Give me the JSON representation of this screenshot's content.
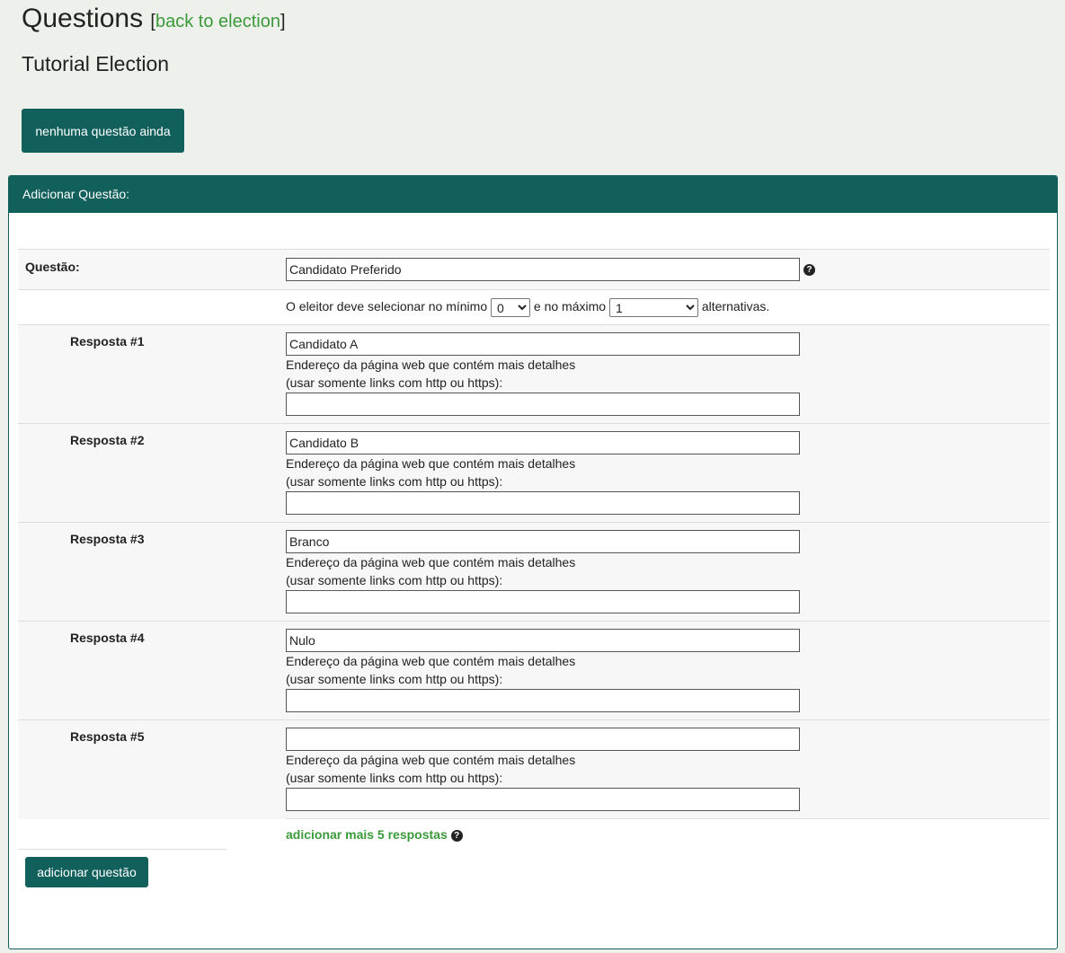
{
  "header": {
    "title": "Questions",
    "bracket_open": "[",
    "back_link": "back to election",
    "bracket_close": "]",
    "election_name": "Tutorial Election",
    "no_questions_button": "nenhuma questão ainda"
  },
  "panel": {
    "title": "Adicionar Questão:",
    "question_label": "Questão:",
    "question_value": "Candidato Preferido",
    "help_icon": "question-circle-icon",
    "min_max": {
      "prefix": "O eleitor deve selecionar no mínimo",
      "min_value": "0",
      "middle": "e no máximo",
      "max_value": "1",
      "suffix": "alternativas."
    },
    "answers": [
      {
        "label": "Resposta #1",
        "value": "Candidato A",
        "url_hint_1": "Endereço da página web que contém mais detalhes",
        "url_hint_2": "(usar somente links com http ou https):",
        "url_value": ""
      },
      {
        "label": "Resposta #2",
        "value": "Candidato B",
        "url_hint_1": "Endereço da página web que contém mais detalhes",
        "url_hint_2": "(usar somente links com http ou https):",
        "url_value": ""
      },
      {
        "label": "Resposta #3",
        "value": "Branco",
        "url_hint_1": "Endereço da página web que contém mais detalhes",
        "url_hint_2": "(usar somente links com http ou https):",
        "url_value": ""
      },
      {
        "label": "Resposta #4",
        "value": "Nulo",
        "url_hint_1": "Endereço da página web que contém mais detalhes",
        "url_hint_2": "(usar somente links com http ou https):",
        "url_value": ""
      },
      {
        "label": "Resposta #5",
        "value": "",
        "url_hint_1": "Endereço da página web que contém mais detalhes",
        "url_hint_2": "(usar somente links com http ou https):",
        "url_value": ""
      }
    ],
    "add_more_link": "adicionar mais 5 respostas",
    "submit_button": "adicionar questão"
  },
  "colors": {
    "accent": "#11605c",
    "link": "#3a9a3a",
    "background": "#eef0eb"
  }
}
